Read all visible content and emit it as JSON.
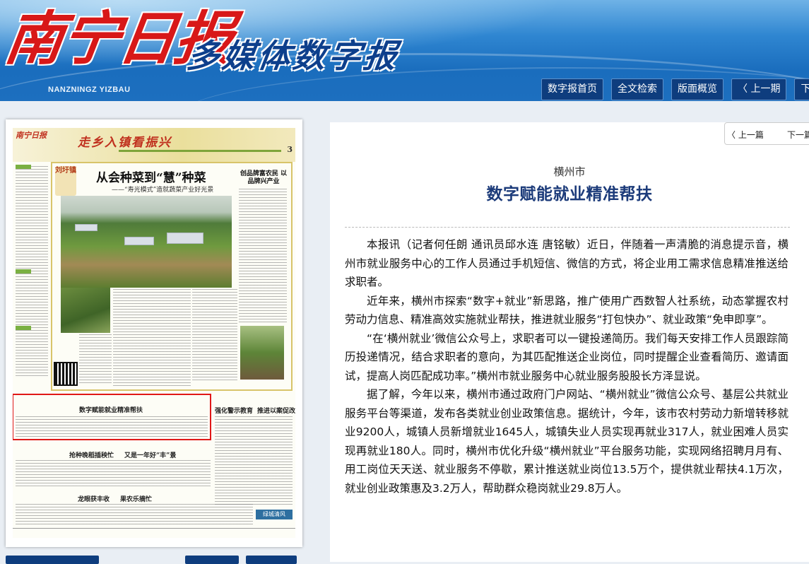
{
  "header": {
    "logo_title": "南宁日报",
    "logo_subtitle": "多媒体数字报",
    "logo_en": "NANZNINGZ YIZBAU"
  },
  "nav": {
    "home": "数字报首页",
    "search": "全文检索",
    "overview": "版面概览",
    "prev_issue": "〈 上一期",
    "next_issue": "下一"
  },
  "pager": {
    "prev": "〈 上一篇",
    "next": "下一篇"
  },
  "thumbnail": {
    "logo_small": "南宁日报",
    "banner": "走乡入镇看振兴",
    "page_number": "3",
    "seal": "刘圩镇",
    "headline": "从会种菜到“慧”种菜",
    "subheadline": "——“寿光模式”造就蔬菜产业好光景",
    "side_title": "创品牌富农民 以品牌兴产业",
    "highlight_title": "数字赋能就业精准帮扶",
    "article_titles": {
      "a1": "强化警示教育",
      "a2": "推进以案促改",
      "a3": "抢种晚稻插秧忙",
      "a4": "又是一年好“丰”景",
      "a5": "龙眼获丰收",
      "a6": "果农乐摘忙"
    },
    "badge": "绿城清风"
  },
  "article": {
    "kicker": "横州市",
    "title": "数字赋能就业精准帮扶",
    "paragraphs": [
      "本报讯（记者何任朗 通讯员邱水连 唐铭敏）近日，伴随着一声清脆的消息提示音，横州市就业服务中心的工作人员通过手机短信、微信的方式，将企业用工需求信息精准推送给求职者。",
      "近年来，横州市探索“数字+就业”新思路，推广使用广西数智人社系统，动态掌握农村劳动力信息、精准高效实施就业帮扶，推进就业服务“打包快办”、就业政策“免申即享”。",
      "“在‘横州就业’微信公众号上，求职者可以一键投递简历。我们每天安排工作人员跟踪简历投递情况，结合求职者的意向，为其匹配推送企业岗位，同时提醒企业查看简历、邀请面试，提高人岗匹配成功率。”横州市就业服务中心就业服务股股长方泽显说。",
      "据了解，今年以来，横州市通过政府门户网站、“横州就业”微信公众号、基层公共就业服务平台等渠道，发布各类就业创业政策信息。据统计，今年，该市农村劳动力新增转移就业9200人，城镇人员新增就业1645人，城镇失业人员实现再就业317人，就业困难人员实现再就业180人。同时，横州市优化升级“横州就业”平台服务功能，实现网络招聘月月有、用工岗位天天送、就业服务不停歇，累计推送就业岗位13.5万个，提供就业帮扶4.1万次，就业创业政策惠及3.2万人，帮助群众稳岗就业29.8万人。"
    ]
  },
  "colors": {
    "header_blue": "#1a6dbd",
    "nav_button": "#0e3d7e",
    "logo_red": "#d81818",
    "headline_blue": "#1c3b7a",
    "highlight_red": "#e01818"
  }
}
